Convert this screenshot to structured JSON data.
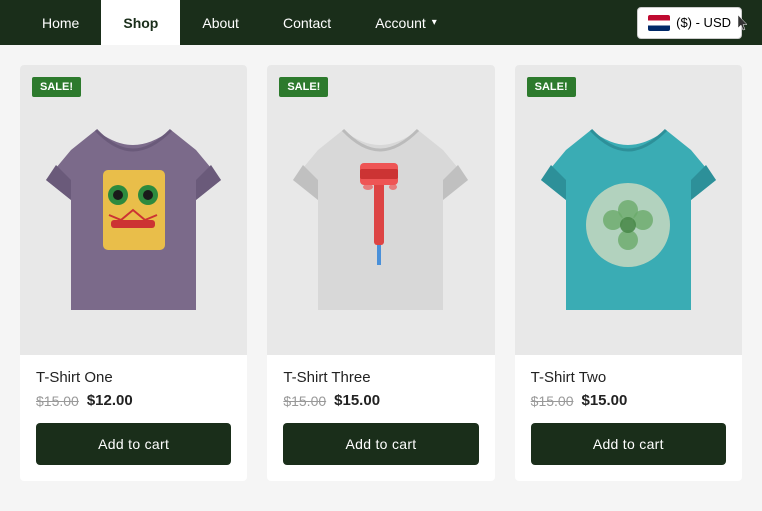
{
  "nav": {
    "items": [
      {
        "label": "Home",
        "active": false
      },
      {
        "label": "Shop",
        "active": true
      },
      {
        "label": "About",
        "active": false
      },
      {
        "label": "Contact",
        "active": false
      }
    ],
    "account_label": "Account",
    "currency_label": "($) - USD"
  },
  "products": [
    {
      "name": "T-Shirt One",
      "price_original": "$15.00",
      "price_sale": "$12.00",
      "sale_badge": "SALE!",
      "add_to_cart": "Add to cart",
      "color": "purple",
      "design": "face"
    },
    {
      "name": "T-Shirt Three",
      "price_original": "$15.00",
      "price_sale": "$15.00",
      "sale_badge": "SALE!",
      "add_to_cart": "Add to cart",
      "color": "lightgray",
      "design": "paint_roller"
    },
    {
      "name": "T-Shirt Two",
      "price_original": "$15.00",
      "price_sale": "$15.00",
      "sale_badge": "SALE!",
      "add_to_cart": "Add to cart",
      "color": "teal",
      "design": "circle"
    }
  ]
}
